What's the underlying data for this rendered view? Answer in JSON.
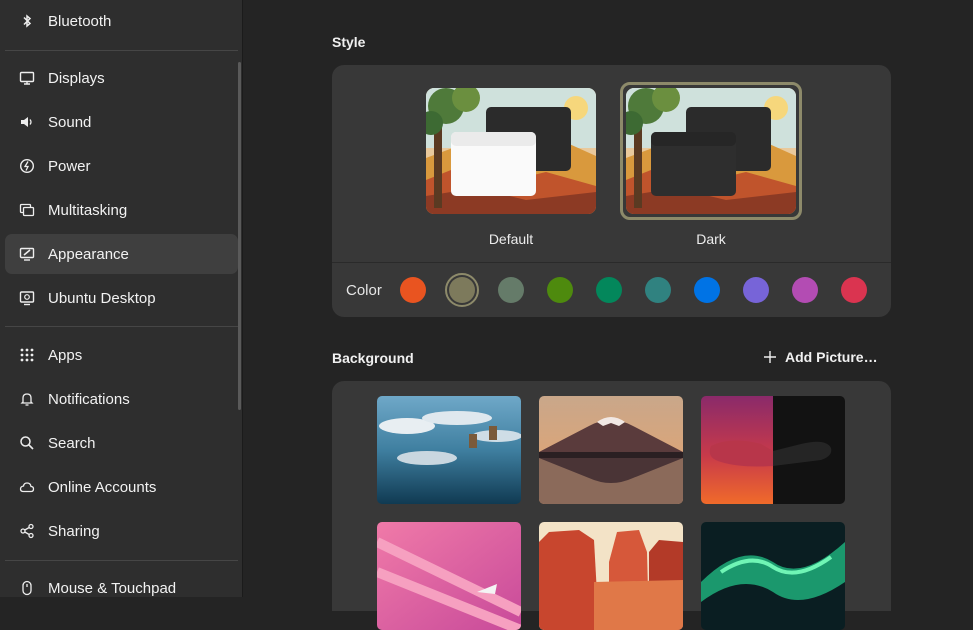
{
  "sidebar": {
    "items": [
      {
        "label": "Bluetooth",
        "icon": "bluetooth-icon"
      },
      {
        "label": "Displays",
        "icon": "display-icon"
      },
      {
        "label": "Sound",
        "icon": "speaker-icon"
      },
      {
        "label": "Power",
        "icon": "power-icon"
      },
      {
        "label": "Multitasking",
        "icon": "multitasking-icon"
      },
      {
        "label": "Appearance",
        "icon": "appearance-icon",
        "active": true
      },
      {
        "label": "Ubuntu Desktop",
        "icon": "ubuntu-desktop-icon"
      },
      {
        "label": "Apps",
        "icon": "apps-grid-icon"
      },
      {
        "label": "Notifications",
        "icon": "bell-icon"
      },
      {
        "label": "Search",
        "icon": "search-icon"
      },
      {
        "label": "Online Accounts",
        "icon": "cloud-icon"
      },
      {
        "label": "Sharing",
        "icon": "share-icon"
      },
      {
        "label": "Mouse & Touchpad",
        "icon": "mouse-icon"
      }
    ]
  },
  "style": {
    "title": "Style",
    "options": [
      {
        "label": "Default",
        "selected": false
      },
      {
        "label": "Dark",
        "selected": true
      }
    ],
    "color_label": "Color",
    "colors": [
      "#e95420",
      "#7d7a5c",
      "#657b69",
      "#4e8a0e",
      "#03875b",
      "#308280",
      "#0073e5",
      "#7764d8",
      "#b34cb3",
      "#da3450"
    ],
    "selected_color": "#7d7a5c"
  },
  "background": {
    "title": "Background",
    "add_picture_label": "Add Picture…",
    "wallpapers": [
      "lake-reflection-wallpaper",
      "mount-fuji-wallpaper",
      "numbat-wallpaper",
      "pink-abstract-wallpaper",
      "red-canyon-wallpaper",
      "aurora-wallpaper"
    ]
  }
}
